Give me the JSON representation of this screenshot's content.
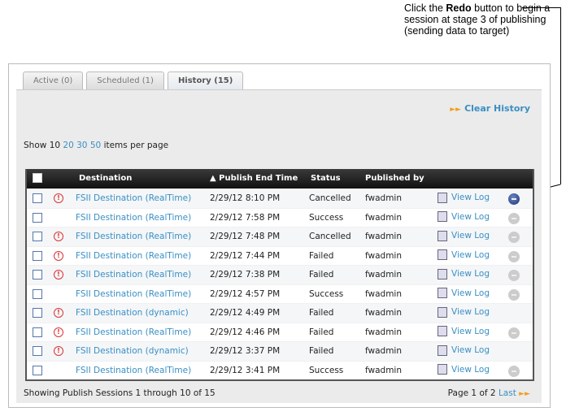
{
  "callout": {
    "pre": "Click the ",
    "bold": "Redo",
    "post": " button to begin a session at stage 3 of publishing (sending data to target)"
  },
  "tabs": [
    "Active (0)",
    "Scheduled (1)",
    "History (15)"
  ],
  "clear_history": "Clear History",
  "per_page": {
    "show": "Show",
    "current": "10",
    "options": [
      "20",
      "30",
      "50"
    ],
    "suffix": "items per page"
  },
  "columns": {
    "destination": "Destination",
    "end_time": "▲ Publish End Time",
    "status": "Status",
    "published_by": "Published by"
  },
  "view_log": "View Log",
  "rows": [
    {
      "alert": true,
      "dest": "FSII Destination (RealTime)",
      "time": "2/29/12 8:10 PM",
      "status": "Cancelled",
      "by": "fwadmin",
      "redo": "active"
    },
    {
      "alert": false,
      "dest": "FSII Destination (RealTime)",
      "time": "2/29/12 7:58 PM",
      "status": "Success",
      "by": "fwadmin",
      "redo": "disabled"
    },
    {
      "alert": true,
      "dest": "FSII Destination (RealTime)",
      "time": "2/29/12 7:48 PM",
      "status": "Cancelled",
      "by": "fwadmin",
      "redo": "disabled"
    },
    {
      "alert": true,
      "dest": "FSII Destination (RealTime)",
      "time": "2/29/12 7:44 PM",
      "status": "Failed",
      "by": "fwadmin",
      "redo": "disabled"
    },
    {
      "alert": true,
      "dest": "FSII Destination (RealTime)",
      "time": "2/29/12 7:38 PM",
      "status": "Failed",
      "by": "fwadmin",
      "redo": "disabled"
    },
    {
      "alert": false,
      "dest": "FSII Destination (RealTime)",
      "time": "2/29/12 4:57 PM",
      "status": "Success",
      "by": "fwadmin",
      "redo": "disabled"
    },
    {
      "alert": true,
      "dest": "FSII Destination (dynamic)",
      "time": "2/29/12 4:49 PM",
      "status": "Failed",
      "by": "fwadmin",
      "redo": "none"
    },
    {
      "alert": true,
      "dest": "FSII Destination (RealTime)",
      "time": "2/29/12 4:46 PM",
      "status": "Failed",
      "by": "fwadmin",
      "redo": "disabled"
    },
    {
      "alert": true,
      "dest": "FSII Destination (dynamic)",
      "time": "2/29/12 3:37 PM",
      "status": "Failed",
      "by": "fwadmin",
      "redo": "none"
    },
    {
      "alert": false,
      "dest": "FSII Destination (RealTime)",
      "time": "2/29/12 3:41 PM",
      "status": "Success",
      "by": "fwadmin",
      "redo": "disabled"
    }
  ],
  "footer": {
    "showing": "Showing Publish Sessions 1 through 10 of 15",
    "page": "Page 1 of 2",
    "last": "Last"
  }
}
